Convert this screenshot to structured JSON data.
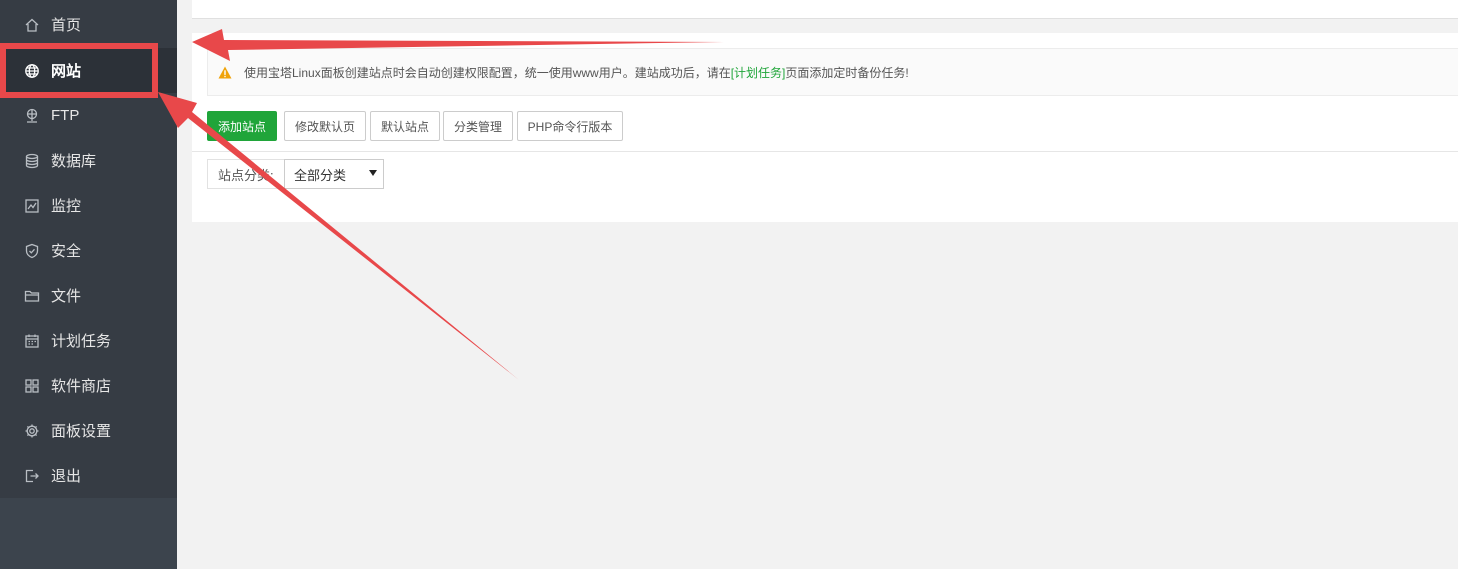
{
  "sidebar": {
    "items": [
      {
        "label": "首页",
        "icon": "home-icon",
        "active": false
      },
      {
        "label": "网站",
        "icon": "globe-icon",
        "active": true
      },
      {
        "label": "FTP",
        "icon": "ftp-icon",
        "active": false
      },
      {
        "label": "数据库",
        "icon": "database-icon",
        "active": false
      },
      {
        "label": "监控",
        "icon": "monitor-icon",
        "active": false
      },
      {
        "label": "安全",
        "icon": "shield-icon",
        "active": false
      },
      {
        "label": "文件",
        "icon": "folder-icon",
        "active": false
      },
      {
        "label": "计划任务",
        "icon": "calendar-icon",
        "active": false
      },
      {
        "label": "软件商店",
        "icon": "grid-icon",
        "active": false
      },
      {
        "label": "面板设置",
        "icon": "gear-icon",
        "active": false
      },
      {
        "label": "退出",
        "icon": "logout-icon",
        "active": false
      }
    ]
  },
  "notice": {
    "text_before": "使用宝塔Linux面板创建站点时会自动创建权限配置，统一使用www用户。建站成功后，请在",
    "link": "[计划任务]",
    "text_after": "页面添加定时备份任务!"
  },
  "toolbar": {
    "add_site": "添加站点",
    "edit_default_page": "修改默认页",
    "default_site": "默认站点",
    "category_manage": "分类管理",
    "php_cli_version": "PHP命令行版本"
  },
  "filter": {
    "label": "站点分类:",
    "selected": "全部分类"
  },
  "colors": {
    "sidebar_bg": "#363c44",
    "sidebar_active": "#2c3138",
    "accent_green": "#20a53a",
    "annotation_red": "#e8484a"
  }
}
